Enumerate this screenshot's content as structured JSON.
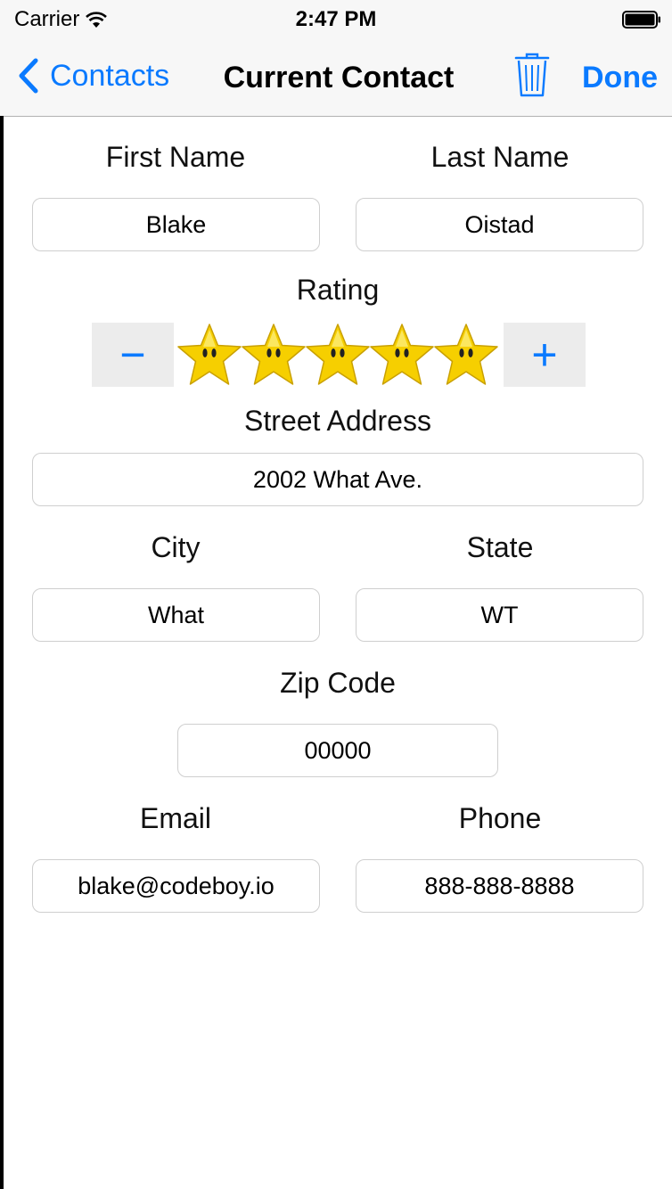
{
  "status_bar": {
    "carrier": "Carrier",
    "time": "2:47 PM"
  },
  "nav": {
    "back_label": "Contacts",
    "title": "Current Contact",
    "done_label": "Done"
  },
  "form": {
    "first_name_label": "First Name",
    "first_name_value": "Blake",
    "last_name_label": "Last Name",
    "last_name_value": "Oistad",
    "rating_label": "Rating",
    "rating_value": 5,
    "rating_max": 5,
    "decrement_label": "−",
    "increment_label": "+",
    "street_label": "Street Address",
    "street_value": "2002 What Ave.",
    "city_label": "City",
    "city_value": "What",
    "state_label": "State",
    "state_value": "WT",
    "zip_label": "Zip Code",
    "zip_value": "00000",
    "email_label": "Email",
    "email_value": "blake@codeboy.io",
    "phone_label": "Phone",
    "phone_value": "888-888-8888"
  },
  "colors": {
    "accent": "#0a7aff",
    "star_fill": "#f6cf00"
  }
}
